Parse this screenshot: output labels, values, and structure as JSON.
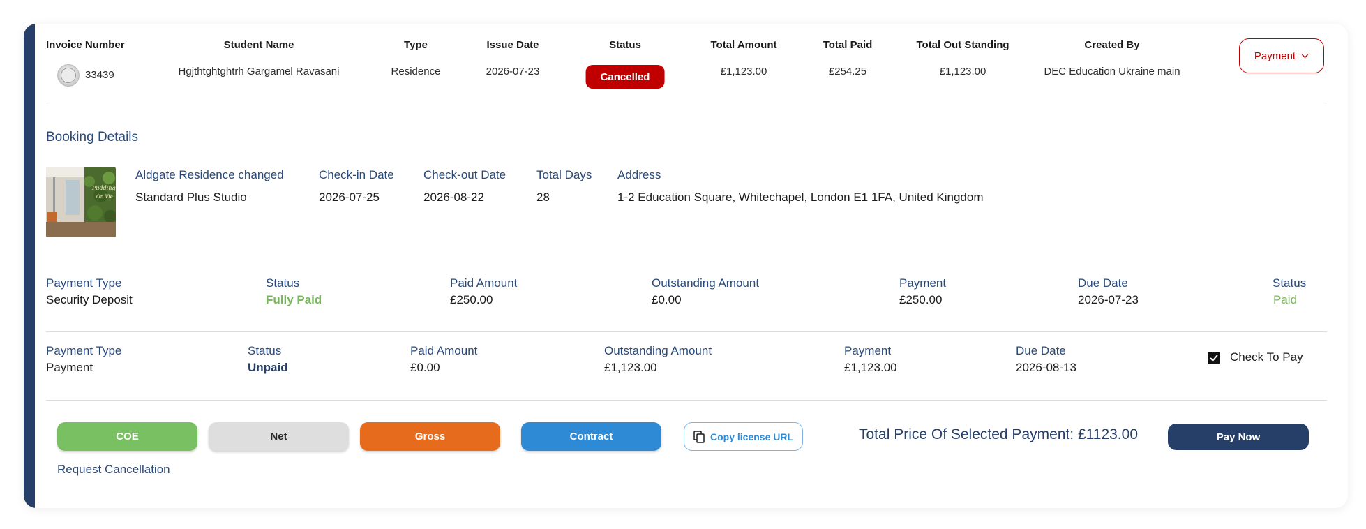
{
  "invoice_header": {
    "columns": {
      "invoice_number": "Invoice Number",
      "student_name": "Student Name",
      "type": "Type",
      "issue_date": "Issue Date",
      "status": "Status",
      "total_amount": "Total Amount",
      "total_paid": "Total Paid",
      "total_outstanding": "Total Out Standing",
      "created_by": "Created By"
    },
    "row": {
      "logo_icon": "school-seal-icon",
      "invoice_number": "33439",
      "student_name": "Hgjthtghtghtrh Gargamel Ravasani",
      "type": "Residence",
      "issue_date": "2026-07-23",
      "status": "Cancelled",
      "total_amount": "£1,123.00",
      "total_paid": "£254.25",
      "total_outstanding": "£1,123.00",
      "created_by": "DEC Education Ukraine main"
    },
    "payment_dropdown_label": "Payment"
  },
  "booking": {
    "section_title": "Booking Details",
    "residence_name": "Aldgate Residence changed",
    "room_type": "Standard Plus Studio",
    "check_in_label": "Check-in Date",
    "check_in": "2026-07-25",
    "check_out_label": "Check-out Date",
    "check_out": "2026-08-22",
    "total_days_label": "Total Days",
    "total_days": "28",
    "address_label": "Address",
    "address": "1-2 Education Square, Whitechapel, London E1 1FA, United Kingdom"
  },
  "payments": [
    {
      "type_label": "Payment Type",
      "type": "Security Deposit",
      "status_label": "Status",
      "status": "Fully Paid",
      "paid_label": "Paid Amount",
      "paid": "£250.00",
      "outstanding_label": "Outstanding Amount",
      "outstanding": "£0.00",
      "payment_label": "Payment",
      "payment": "£250.00",
      "due_label": "Due Date",
      "due": "2026-07-23",
      "status2_label": "Status",
      "status2": "Paid"
    },
    {
      "type_label": "Payment Type",
      "type": "Payment",
      "status_label": "Status",
      "status": "Unpaid",
      "paid_label": "Paid Amount",
      "paid": "£0.00",
      "outstanding_label": "Outstanding Amount",
      "outstanding": "£1,123.00",
      "payment_label": "Payment",
      "payment": "£1,123.00",
      "due_label": "Due Date",
      "due": "2026-08-13",
      "check_label": "Check To Pay",
      "checked": true
    }
  ],
  "actions": {
    "coe": "COE",
    "net": "Net",
    "gross": "Gross",
    "contract": "Contract",
    "copy_license": "Copy license URL",
    "total_price": "Total Price Of Selected Payment: £1123.00",
    "pay_now": "Pay Now",
    "request_cancellation": "Request Cancellation"
  },
  "colors": {
    "primary_navy": "#263f69",
    "status_cancelled": "#c00000",
    "paid_green": "#79b858",
    "coe_green": "#79c063",
    "gross_orange": "#e66b1c",
    "contract_blue": "#2f8ad6"
  }
}
